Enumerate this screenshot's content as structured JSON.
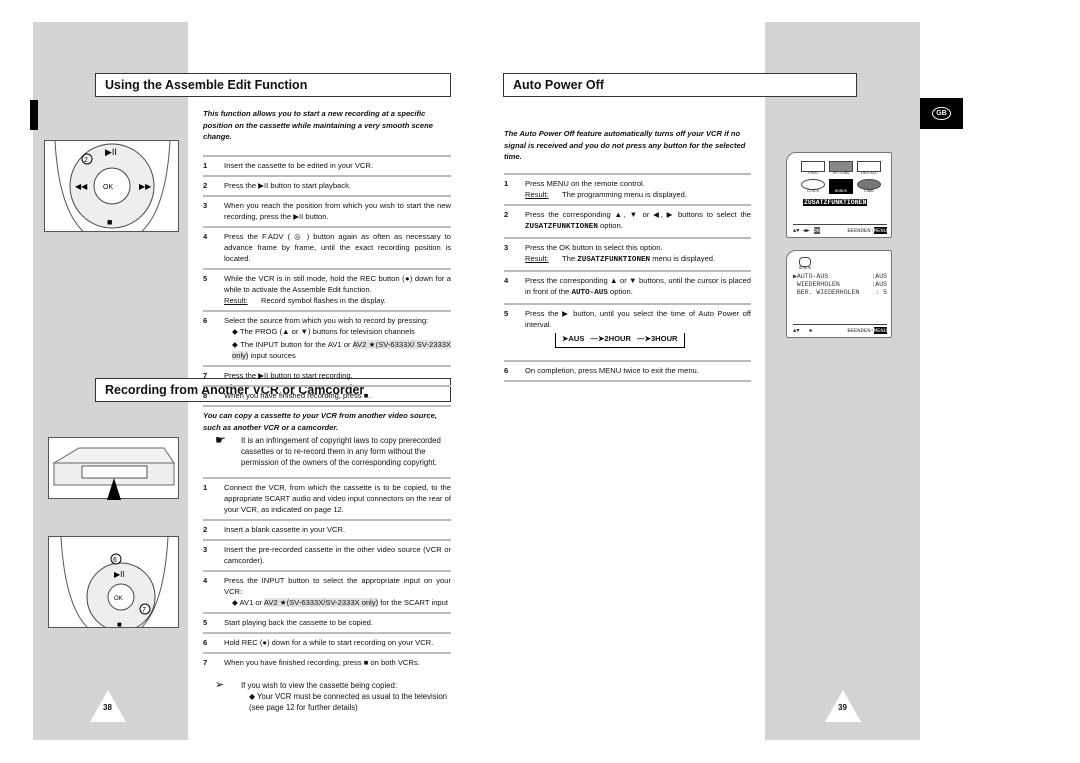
{
  "assemble": {
    "title": "Using the Assemble Edit Function",
    "intro": "This function allows you to start a new recording at a specific position on the cassette while maintaining a very smooth scene change.",
    "steps": [
      {
        "n": "1",
        "t": "Insert the cassette to be edited in your VCR."
      },
      {
        "n": "2",
        "t": "Press the ▶II button to start playback."
      },
      {
        "n": "3",
        "t": "When you reach the position from which you wish to start the new recording, press the ▶II button."
      },
      {
        "n": "4",
        "t": "Press the F.ADV ( ◎ ) button again as often as necessary to advance frame by frame, until the exact recording position is located."
      },
      {
        "n": "5",
        "t": "While the VCR is in still mode, hold the REC button (●) down for a while to activate the Assemble Edit function.",
        "rl": "Result:",
        "r": "Record symbol flashes in the display."
      },
      {
        "n": "6",
        "t": "Select the source from which you wish to record by pressing:",
        "b1": "The PROG (▲ or ▼) buttons for television channels",
        "b2a": "The INPUT button for the AV1 or ",
        "b2b": "AV2 ★(SV-6333X/ SV-2333X only)",
        "b2c": " input sources"
      },
      {
        "n": "7",
        "t": "Press the ▶II button to start recording."
      },
      {
        "n": "8",
        "t": "When you have finished recording, press ■."
      }
    ]
  },
  "autopower": {
    "title": "Auto Power Off",
    "intro": "The Auto Power Off feature automatically turns off your VCR if no signal is received and you do not press any button for the selected time.",
    "steps": [
      {
        "n": "1",
        "t": "Press MENU on the remote control.",
        "rl": "Result:",
        "r": "The programming menu is displayed."
      },
      {
        "n": "2",
        "t": "Press the corresponding ▲, ▼ or ◀, ▶ buttons to select the",
        "m": "ZUSATZFUNKTIONEN",
        "t2": " option."
      },
      {
        "n": "3",
        "t": "Press the OK button to select this option.",
        "rl": "Result:",
        "r1": "The ",
        "m": "ZUSATZFUNKTIONEN",
        "r2": " menu is displayed."
      },
      {
        "n": "4",
        "t": "Press the corresponding ▲ or ▼ buttons, until the cursor is placed in front of the ",
        "m": "AUTO-AUS",
        "t2": " option."
      },
      {
        "n": "5",
        "t": "Press the ▶ button, until you select the time of Auto Power off interval.",
        "cycle": [
          "AUS",
          "2HOUR",
          "3HOUR"
        ]
      },
      {
        "n": "6",
        "t": "On completion, press MENU twice to exit the menu."
      }
    ]
  },
  "recording": {
    "title": "Recording from Another VCR or Camcorder",
    "intro": "You can copy a cassette to your VCR from another video source, such as another VCR or a camcorder.",
    "note": "It is an infringement of copyright laws to copy prerecorded cassettes or to re-record them in any form without the permission of the owners of the corresponding copyright.",
    "steps": [
      {
        "n": "1",
        "t": "Connect the VCR, from which the cassette is to be copied, to the appropriate SCART audio and video input connectors on the rear of your VCR, as indicated on page 12."
      },
      {
        "n": "2",
        "t": "Insert a blank cassette in your VCR."
      },
      {
        "n": "3",
        "t": "Insert the pre-recorded cassette in the other video source (VCR or camcorder)."
      },
      {
        "n": "4",
        "t": "Press the INPUT button to select the appropriate input on your VCR:",
        "b1a": "AV1 or ",
        "b1b": "AV2 ★(SV-6333X/SV-2333X only)",
        "b1c": " for the SCART input"
      },
      {
        "n": "5",
        "t": "Start playing back the cassette to be copied."
      },
      {
        "n": "6",
        "t": "Hold REC (●) down for a while to start recording on your VCR."
      },
      {
        "n": "7",
        "t": "When you have finished recording, press ■ on both VCRs."
      }
    ],
    "tip": "If you wish to view the cassette being copied:",
    "tip_bullet": "Your VCR must be connected as usual to the television (see page 12 for further details)"
  },
  "osd1": {
    "icons": [
      "PROG",
      "OPTIONS",
      "INSTALL",
      "CLOCK",
      "BONUS",
      "LANG"
    ],
    "selected": "ZUSATZFUNKTIONEN",
    "nav": "▲▼ ◀▶",
    "ok": "OK",
    "exit": "BEENDEN:",
    "menu": "MENU"
  },
  "osd2": {
    "icon": "BONUS",
    "rows": [
      [
        "▶AUTO-AUS",
        ":AUS"
      ],
      [
        " WIEDERHOLEN",
        ":AUS"
      ],
      [
        " BER. WIEDERHOLEN",
        ": 5"
      ]
    ],
    "nav": "▲▼   ▶",
    "exit": "BEENDEN:",
    "menu": "MENU"
  },
  "lang_badge": "GB",
  "page_left": "38",
  "page_right": "39"
}
